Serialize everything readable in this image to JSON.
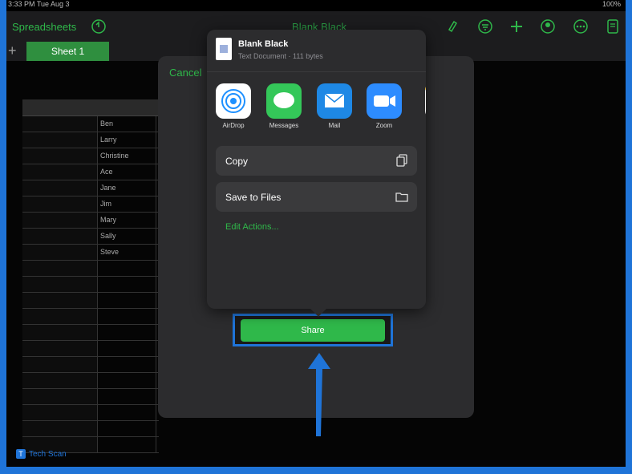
{
  "status": {
    "left": "3:33 PM  Tue Aug 3",
    "right": "100%"
  },
  "toolbar": {
    "back_label": "Spreadsheets",
    "title": "Blank Black"
  },
  "tabs": {
    "sheet_label": "Sheet 1"
  },
  "sheet": {
    "names": [
      "Ben",
      "Larry",
      "Christine",
      "Ace",
      "Jane",
      "Jim",
      "Mary",
      "Sally",
      "Steve"
    ]
  },
  "dialog": {
    "cancel_label": "Cancel",
    "share_label": "Share"
  },
  "share_sheet": {
    "title": "Blank Black",
    "subtitle": "Text Document · 111 bytes",
    "apps": [
      {
        "label": "AirDrop",
        "color": "#1e90ff"
      },
      {
        "label": "Messages",
        "color": "#34c759"
      },
      {
        "label": "Mail",
        "color": "#1e88e5"
      },
      {
        "label": "Zoom",
        "color": "#2d8cff"
      }
    ],
    "actions": {
      "copy_label": "Copy",
      "save_label": "Save to Files",
      "edit_label": "Edit Actions..."
    }
  },
  "watermark": {
    "text": "Tech Scan"
  },
  "colors": {
    "accent": "#2fb84a",
    "highlight": "#1f74d8",
    "sheet_bg": "#2c2c2e"
  }
}
